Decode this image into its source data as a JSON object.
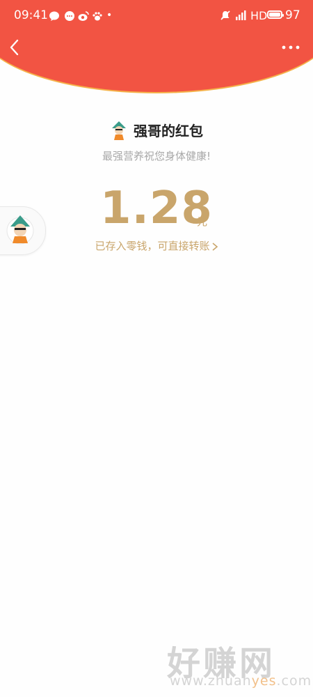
{
  "status_bar": {
    "time": "09:41",
    "network": "HD",
    "battery": "97",
    "battery_level": 0.97
  },
  "header": {
    "back_icon": "chevron-left-icon",
    "more_icon": "more-horizontal-icon",
    "bg_color": "#f25443"
  },
  "red_packet": {
    "sender_name": "强哥的红包",
    "wish": "最强营养祝您身体健康!",
    "amount": "1.28",
    "unit": "元",
    "note": "已存入零钱，可直接转账"
  },
  "watermark": {
    "title": "好赚网",
    "site_prefix": "www.zhuan",
    "site_highlight": "yes",
    "site_suffix": ".com"
  },
  "colors": {
    "accent": "#c9a56b",
    "header_red": "#f25443"
  }
}
